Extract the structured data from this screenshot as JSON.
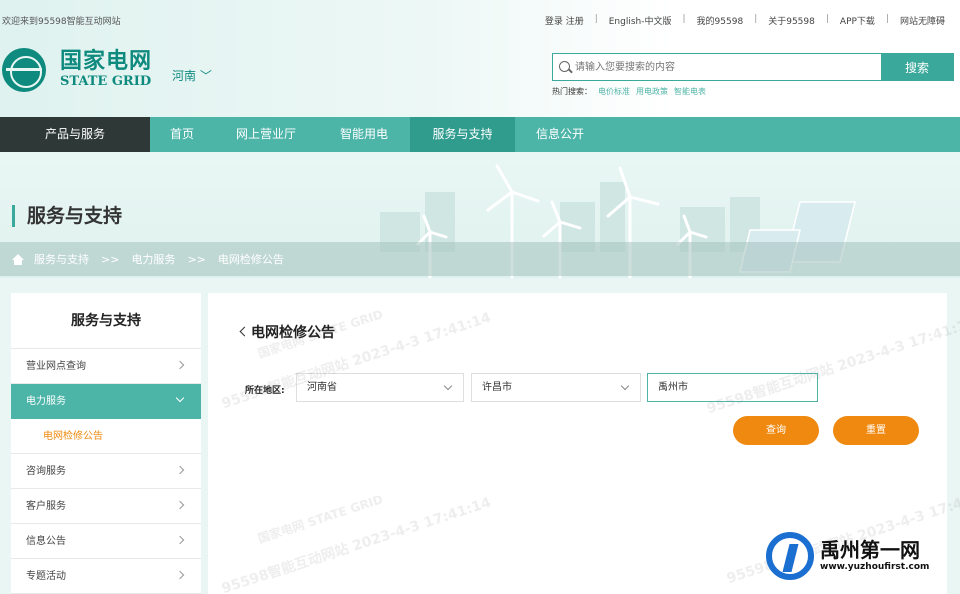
{
  "header": {
    "welcome": "欢迎来到95598智能互动网站",
    "links": [
      "登录 注册",
      "English-中文版",
      "我的95598",
      "关于95598",
      "APP下载",
      "网站无障碍"
    ],
    "logo_cn": "国家电网",
    "logo_en": "STATE GRID",
    "region": "河南"
  },
  "search": {
    "placeholder": "请输入您要搜索的内容",
    "button": "搜索",
    "hot_label": "热门搜索：",
    "hot_keywords": [
      "电价标准",
      "用电政策",
      "智能电表"
    ]
  },
  "nav": [
    "产品与服务",
    "首页",
    "网上营业厅",
    "智能用电",
    "服务与支持",
    "信息公开"
  ],
  "banner": {
    "title": "服务与支持",
    "breadcrumb": [
      "服务与支持",
      "电力服务",
      "电网检修公告"
    ],
    "breadcrumb_sep": ">>"
  },
  "sidebar": {
    "title": "服务与支持",
    "items": [
      {
        "label": "营业网点查询"
      },
      {
        "label": "电力服务"
      },
      {
        "label": "电网检修公告"
      },
      {
        "label": "咨询服务"
      },
      {
        "label": "客户服务"
      },
      {
        "label": "信息公告"
      },
      {
        "label": "专题活动"
      }
    ]
  },
  "main": {
    "title": "电网检修公告",
    "area_label": "所在地区:",
    "province": "河南省",
    "city": "许昌市",
    "county": "禹州市",
    "query_button": "查询",
    "reset_button": "重置",
    "watermark": "95598智能互动网站 2023-4-3 17:41:14",
    "watermark_brand": "国家电网 STATE GRID"
  },
  "corner_logo": {
    "cn": "禹州第一网",
    "url": "www.yuzhoufirst.com"
  }
}
